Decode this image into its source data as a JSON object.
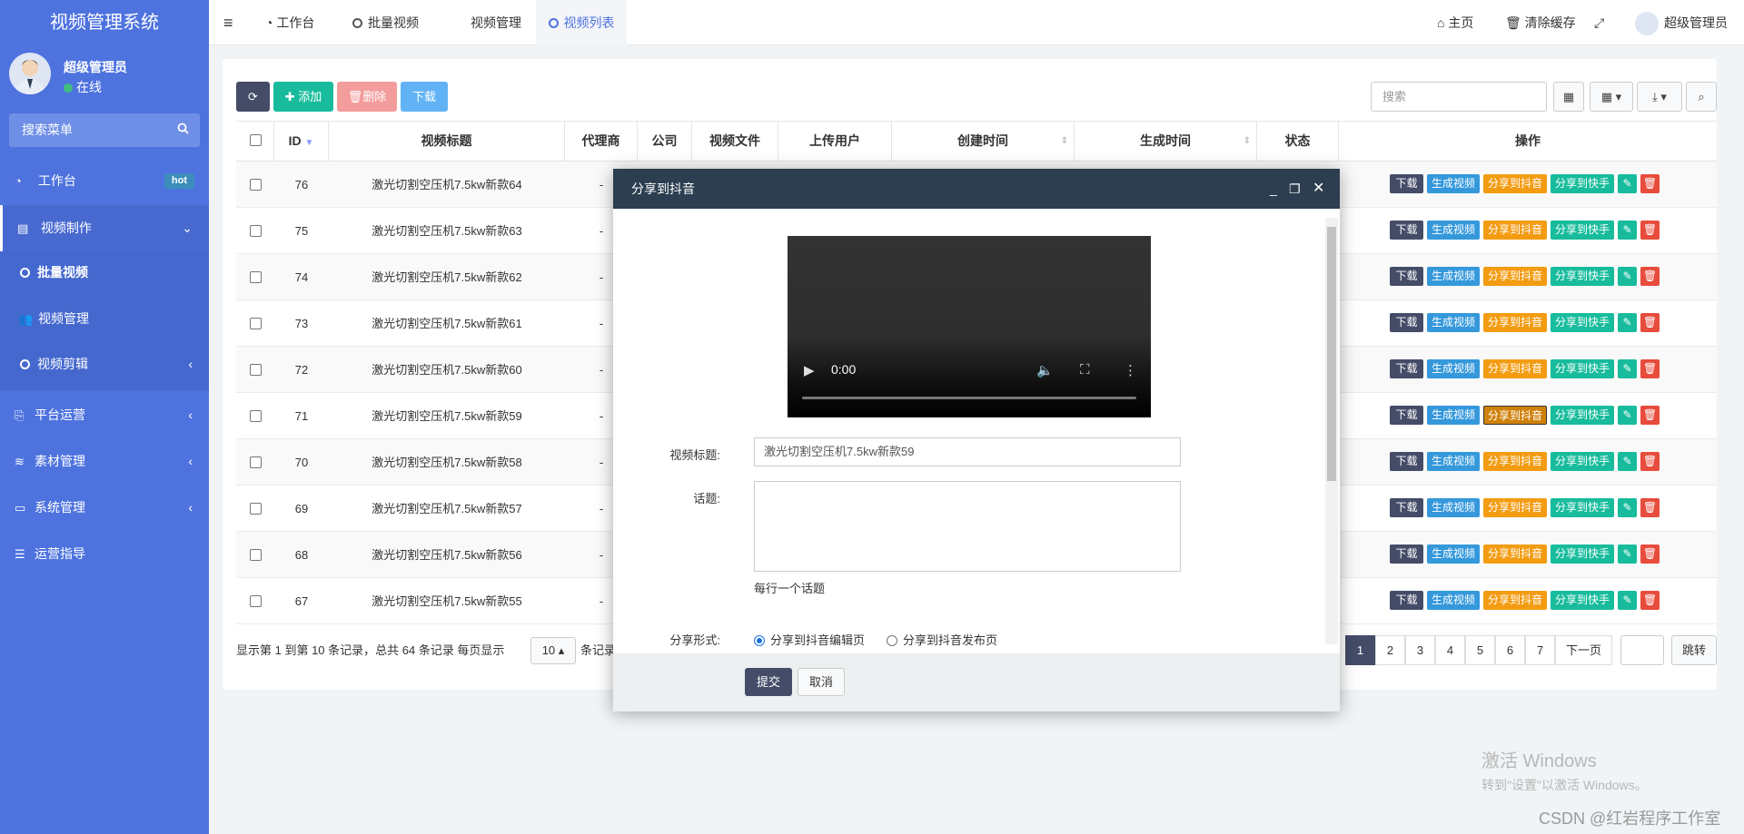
{
  "sidebar": {
    "logo": "视频管理系统",
    "user_name": "超级管理员",
    "user_status": "在线",
    "search_placeholder": "搜索菜单",
    "items": [
      {
        "label": "工作台",
        "badge": "hot",
        "icon": "dashboard-icon"
      },
      {
        "label": "视频制作",
        "icon": "film-icon"
      },
      {
        "label": "批量视频",
        "icon": "circle-icon"
      },
      {
        "label": "视频管理",
        "icon": "users-icon"
      },
      {
        "label": "视频剪辑",
        "icon": "circle-icon"
      },
      {
        "label": "平台运营",
        "icon": "share-icon"
      },
      {
        "label": "素材管理",
        "icon": "layers-icon"
      },
      {
        "label": "系统管理",
        "icon": "desktop-icon"
      },
      {
        "label": "运营指导",
        "icon": "list-icon"
      }
    ]
  },
  "topbar": {
    "tabs": [
      "工作台",
      "批量视频",
      "视频管理",
      "视频列表"
    ],
    "home": "主页",
    "clear_cache": "清除缓存",
    "admin": "超级管理员"
  },
  "toolbar": {
    "add": "添加",
    "delete": "删除",
    "download": "下载",
    "search_placeholder": "搜索"
  },
  "table": {
    "headers": [
      "ID",
      "视频标题",
      "代理商",
      "公司",
      "视频文件",
      "上传用户",
      "创建时间",
      "生成时间",
      "状态",
      "操作"
    ],
    "rows": [
      {
        "id": "76",
        "title": "激光切割空压机7.5kw新款64",
        "agent": "-"
      },
      {
        "id": "75",
        "title": "激光切割空压机7.5kw新款63",
        "agent": "-"
      },
      {
        "id": "74",
        "title": "激光切割空压机7.5kw新款62",
        "agent": "-"
      },
      {
        "id": "73",
        "title": "激光切割空压机7.5kw新款61",
        "agent": "-"
      },
      {
        "id": "72",
        "title": "激光切割空压机7.5kw新款60",
        "agent": "-"
      },
      {
        "id": "71",
        "title": "激光切割空压机7.5kw新款59",
        "agent": "-"
      },
      {
        "id": "70",
        "title": "激光切割空压机7.5kw新款58",
        "agent": "-"
      },
      {
        "id": "69",
        "title": "激光切割空压机7.5kw新款57",
        "agent": "-"
      },
      {
        "id": "68",
        "title": "激光切割空压机7.5kw新款56",
        "agent": "-"
      },
      {
        "id": "67",
        "title": "激光切割空压机7.5kw新款55",
        "agent": "-"
      }
    ],
    "actions": {
      "download": "下载",
      "generate": "生成视频",
      "douyin": "分享到抖音",
      "kuaishou": "分享到快手"
    }
  },
  "pagination": {
    "info": "显示第 1 到第 10 条记录，总共 64 条记录 每页显示",
    "page_size": "10",
    "info_tail": "条记录",
    "pages": [
      "1",
      "2",
      "3",
      "4",
      "5",
      "6",
      "7"
    ],
    "next": "下一页",
    "jump": "跳转"
  },
  "modal": {
    "title": "分享到抖音",
    "video_time": "0:00",
    "label_title": "视频标题:",
    "title_value": "激光切割空压机7.5kw新款59",
    "label_topic": "话题:",
    "topic_help": "每行一个话题",
    "label_share": "分享形式:",
    "share_options": [
      "分享到抖音编辑页",
      "分享到抖音发布页"
    ],
    "submit": "提交",
    "cancel": "取消"
  },
  "watermark": {
    "line1": "激活 Windows",
    "line2": "转到\"设置\"以激活 Windows。",
    "csdn": "CSDN @红岩程序工作室"
  },
  "colors": {
    "sidebar": "#4e73df",
    "primary": "#444c68",
    "success": "#18bc9c",
    "warning": "#f39c12",
    "info": "#3498db",
    "danger": "#e74c3c"
  }
}
